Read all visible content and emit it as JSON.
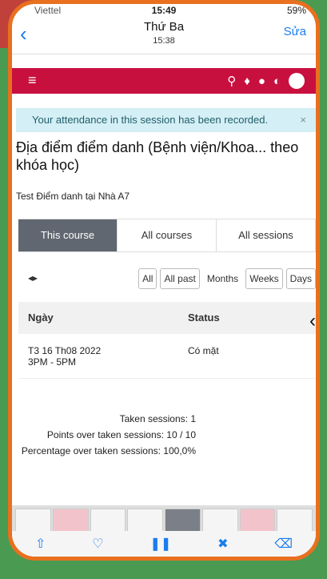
{
  "status_bar": {
    "carrier": "Viettel",
    "time": "15:49",
    "battery": "59%"
  },
  "header": {
    "title": "Thứ Ba",
    "subtitle": "15:38",
    "back_icon": "chevron-left-icon",
    "edit_label": "Sửa"
  },
  "navbar": {
    "menu_icon": "≡",
    "icons": [
      "search-icon",
      "bell-icon",
      "chat-icon",
      "globe-icon",
      "avatar"
    ]
  },
  "alert": {
    "text": "Your attendance in this session has been recorded.",
    "close": "×"
  },
  "page": {
    "title": "Địa điểm điểm danh (Bệnh viện/Khoa... theo khóa học)",
    "location": "Test Điểm danh tại Nhà A7"
  },
  "tabs": [
    {
      "label": "This course",
      "active": true
    },
    {
      "label": "All courses",
      "active": false
    },
    {
      "label": "All sessions",
      "active": false
    }
  ],
  "view_buttons": {
    "arrows": "◂▸",
    "all": "All",
    "all_past": "All past",
    "months": "Months",
    "weeks": "Weeks",
    "days": "Days"
  },
  "table": {
    "headers": {
      "date": "Ngày",
      "status": "Status"
    },
    "rows": [
      {
        "date": "T3 16 Th08 2022",
        "time": "3PM - 5PM",
        "status": "Có mặt"
      }
    ]
  },
  "stats": {
    "taken": "Taken sessions: 1",
    "points": "Points over taken sessions: 10 / 10",
    "percentage": "Percentage over taken sessions: 100,0%"
  },
  "colors": {
    "navbar": "#c8103f",
    "active_tab": "#616770",
    "alert_bg": "#d4eff5",
    "link": "#1a7cf0"
  }
}
